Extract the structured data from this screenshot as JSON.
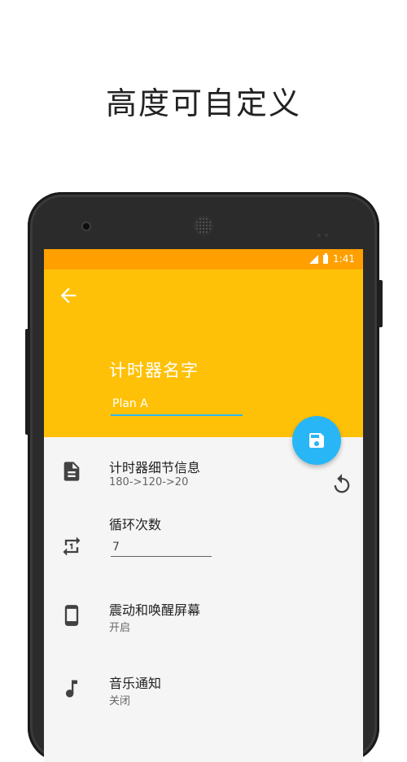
{
  "headline": "高度可自定义",
  "status_bar": {
    "time": "1:41"
  },
  "app_bar": {
    "title": "计时器名字",
    "name_input": {
      "value": "Plan A"
    }
  },
  "settings": [
    {
      "key": "details",
      "title": "计时器细节信息",
      "subtitle": "180->120->20",
      "icon": "document-icon"
    },
    {
      "key": "loops",
      "title": "循环次数",
      "value": "7",
      "icon": "repeat-one-icon"
    },
    {
      "key": "vibrate",
      "title": "震动和唤醒屏幕",
      "subtitle": "开启",
      "icon": "phone-icon"
    },
    {
      "key": "music",
      "title": "音乐通知",
      "subtitle": "关闭",
      "icon": "music-note-icon"
    }
  ],
  "colors": {
    "status_bar": "#ffa000",
    "app_bar": "#ffc107",
    "fab": "#29b6f6",
    "accent_underline": "#29b6f6"
  }
}
